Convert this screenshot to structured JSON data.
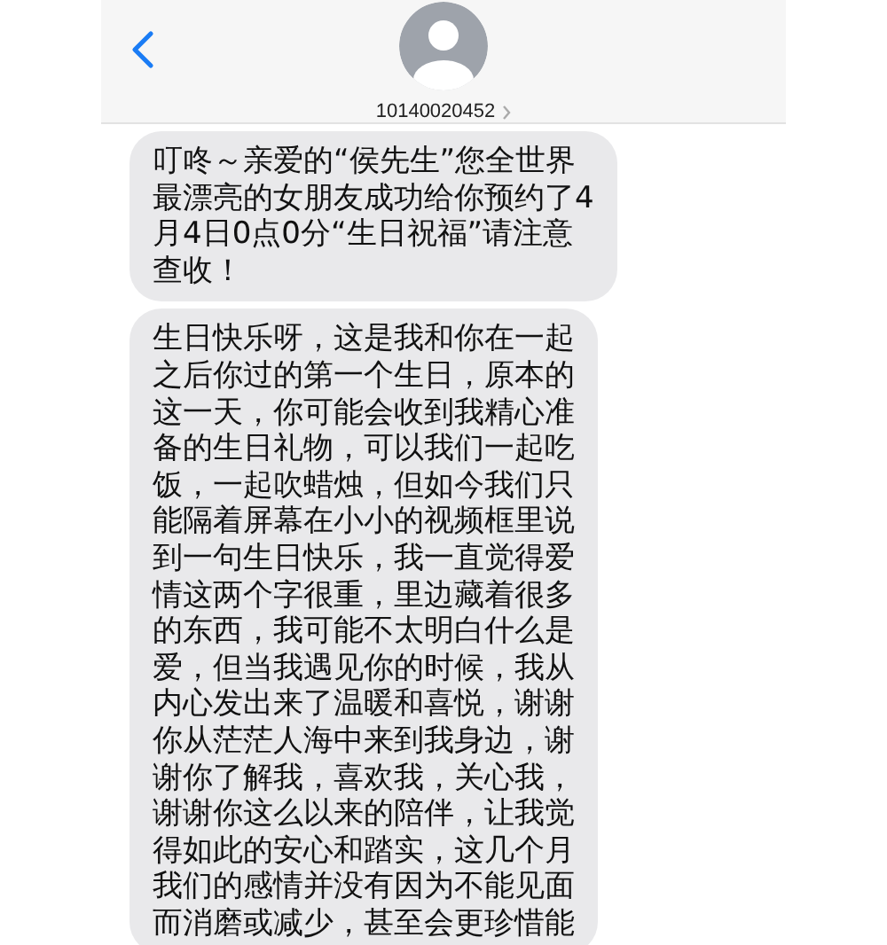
{
  "header": {
    "contact": "10140020452"
  },
  "messages": [
    {
      "lines": [
        "叮咚～亲爱的“侯先生”您全世界",
        "最漂亮的女朋友成功给你预约了4",
        "月4日0点0分“生日祝福”请注意",
        "查收！"
      ]
    },
    {
      "lines": [
        "生日快乐呀，这是我和你在一起",
        "之后你过的第一个生日，原本的",
        "这一天，你可能会收到我精心准",
        "备的生日礼物，可以我们一起吃",
        "饭，一起吹蜡烛，但如今我们只",
        "能隔着屏幕在小小的视频框里说",
        "到一句生日快乐，我一直觉得爱",
        "情这两个字很重，里边藏着很多",
        "的东西，我可能不太明白什么是",
        "爱，但当我遇见你的时候，我从",
        "内心发出来了温暖和喜悦，谢谢",
        "你从茫茫人海中来到我身边，谢",
        "谢你了解我，喜欢我，关心我，",
        "谢谢你这么以来的陪伴，让我觉",
        "得如此的安心和踏实，这几个月",
        "我们的感情并没有因为不能见面",
        "而消磨或减少，甚至会更珍惜能"
      ]
    }
  ]
}
